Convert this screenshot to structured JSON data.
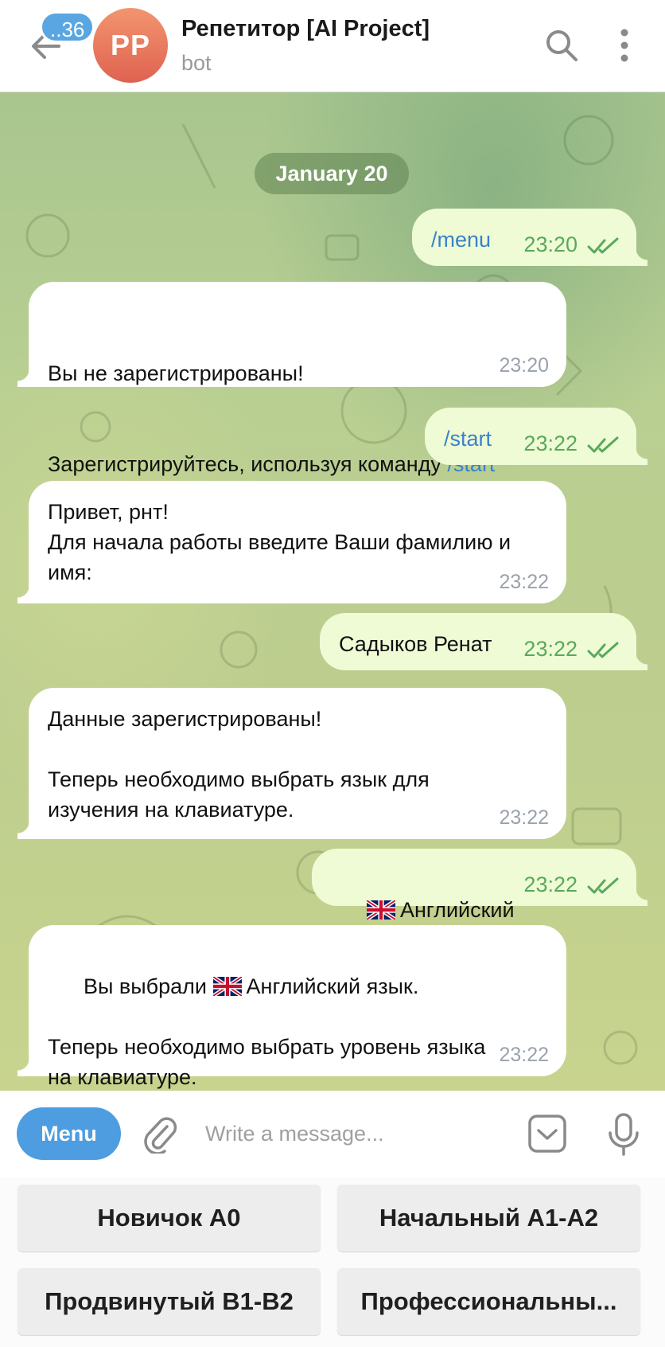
{
  "header": {
    "unread_badge": "..36",
    "avatar_initials": "PP",
    "title": "Репетитор [AI Project]",
    "subtitle": "bot"
  },
  "chat": {
    "date": "January 20",
    "messages": [
      {
        "dir": "out",
        "cmd": "/menu",
        "time": "23:20"
      },
      {
        "dir": "in",
        "line1": "Вы не зарегистрированы!",
        "line2": "Зарегистрируйтесь, используя команду ",
        "cmd": "/start",
        "time": "23:20"
      },
      {
        "dir": "out",
        "cmd": "/start",
        "time": "23:22"
      },
      {
        "dir": "in",
        "text": "Привет, рнт!\nДля начала работы введите Ваши фамилию и\nимя:",
        "time": "23:22"
      },
      {
        "dir": "out",
        "text": "Садыков Ренат",
        "time": "23:22"
      },
      {
        "dir": "in",
        "text": "Данные зарегистрированы!\n\nТеперь необходимо выбрать язык для\nизучения на клавиатуре.",
        "time": "23:22"
      },
      {
        "dir": "out",
        "text": "Английский",
        "time": "23:22"
      },
      {
        "dir": "in",
        "line1_a": "Вы выбрали ",
        "line1_b": "Английский язык.",
        "rest": "\n\nТеперь необходимо выбрать уровень языка\nна клавиатуре.",
        "time": "23:22"
      }
    ]
  },
  "input": {
    "menu_label": "Menu",
    "placeholder": "Write a message..."
  },
  "keyboard": {
    "buttons": [
      "Новичок A0",
      "Начальный A1-A2",
      "Продвинутый B1-B2",
      "Профессиональны..."
    ]
  },
  "icons": {
    "back": "arrow-left-icon",
    "search": "search-icon",
    "more": "more-vertical-icon",
    "attach": "paperclip-icon",
    "keyboard": "keyboard-toggle-icon",
    "mic": "microphone-icon",
    "read": "double-check-icon",
    "flag": "uk-flag-icon"
  },
  "colors": {
    "accent": "#4d9de0",
    "out_bubble": "#effbd5",
    "read_ticks": "#58a95b",
    "avatar": "#e57058"
  }
}
